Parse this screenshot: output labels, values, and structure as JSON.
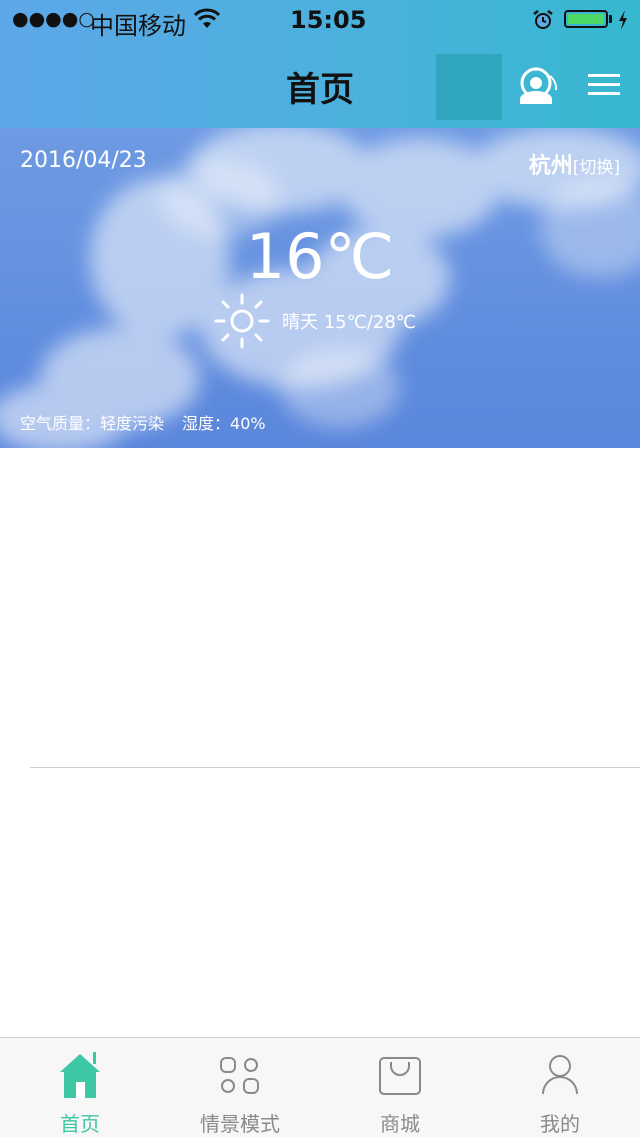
{
  "status_bar": {
    "signal": "●●●●○",
    "carrier": "中国移动",
    "time": "15:05"
  },
  "nav": {
    "title": "首页"
  },
  "weather": {
    "date": "2016/04/23",
    "city": "杭州",
    "switch_label": "[切换]",
    "temperature": "16℃",
    "condition": "晴天 15℃/28℃",
    "air_quality": "空气质量：轻度污染",
    "humidity": "湿度：40%"
  },
  "tabs": [
    {
      "label": "首页",
      "icon": "home-icon",
      "active": true
    },
    {
      "label": "情景模式",
      "icon": "scenes-icon",
      "active": false
    },
    {
      "label": "商城",
      "icon": "shop-icon",
      "active": false
    },
    {
      "label": "我的",
      "icon": "profile-icon",
      "active": false
    }
  ],
  "colors": {
    "accent": "#3ec7a4",
    "inactive": "#8a8a8a"
  }
}
